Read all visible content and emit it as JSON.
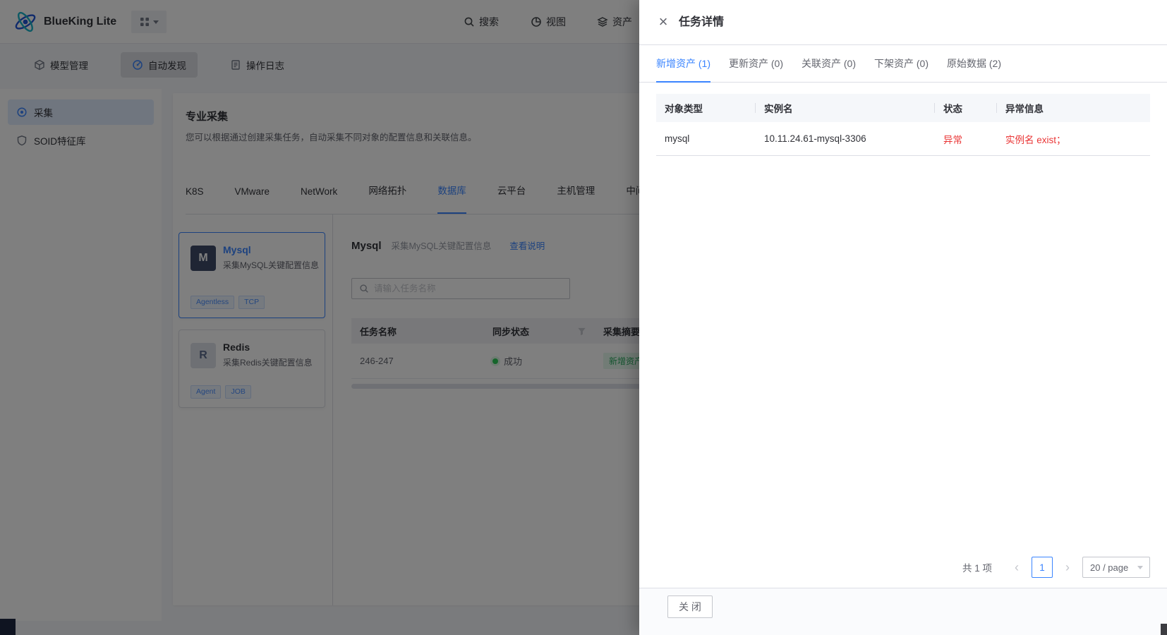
{
  "colors": {
    "accent": "#3a84ff",
    "error": "#ea3636",
    "success": "#2dcb56"
  },
  "icons": {
    "close": "×",
    "prev": "‹",
    "next": "›"
  },
  "navbar": {
    "brand": "BlueKing Lite",
    "search": "搜索",
    "views": "视图",
    "assets": "资产"
  },
  "subnav": {
    "model": "模型管理",
    "discovery": "自动发现",
    "logs": "操作日志"
  },
  "sidebar": {
    "items": [
      {
        "label": "采集"
      },
      {
        "label": "SOID特征库"
      }
    ]
  },
  "panel": {
    "title": "专业采集",
    "desc": "您可以根据通过创建采集任务，自动采集不同对象的配置信息和关联信息。",
    "tabs": [
      {
        "label": "K8S"
      },
      {
        "label": "VMware"
      },
      {
        "label": "NetWork"
      },
      {
        "label": "网络拓扑"
      },
      {
        "label": "数据库"
      },
      {
        "label": "云平台"
      },
      {
        "label": "主机管理"
      },
      {
        "label": "中间件"
      }
    ],
    "cards": [
      {
        "initial": "M",
        "title": "Mysql",
        "desc": "采集MySQL关键配置信息",
        "tags": [
          "Agentless",
          "TCP"
        ]
      },
      {
        "initial": "R",
        "title": "Redis",
        "desc": "采集Redis关键配置信息",
        "tags": [
          "Agent",
          "JOB"
        ]
      }
    ],
    "detail": {
      "title": "Mysql",
      "subtitle": "采集MySQL关键配置信息",
      "doc_link": "查看说明",
      "search_placeholder": "请输入任务名称",
      "table": {
        "col_name": "任务名称",
        "col_status": "同步状态",
        "col_summary": "采集摘要",
        "rows": [
          {
            "name": "246-247",
            "status": "成功",
            "summary": "新增资产:"
          }
        ]
      }
    }
  },
  "drawer": {
    "title": "任务详情",
    "tabs": [
      {
        "label": "新增资产 (1)"
      },
      {
        "label": "更新资产 (0)"
      },
      {
        "label": "关联资产 (0)"
      },
      {
        "label": "下架资产 (0)"
      },
      {
        "label": "原始数据 (2)"
      }
    ],
    "table": {
      "headers": [
        "对象类型",
        "实例名",
        "状态",
        "异常信息"
      ],
      "rows": [
        {
          "type": "mysql",
          "instance": "10.11.24.61-mysql-3306",
          "status": "异常",
          "error": "实例名 exist；"
        }
      ]
    },
    "pagination": {
      "total": "共 1 项",
      "page": "1",
      "per_page": "20 / page"
    },
    "close_label": "关 闭"
  }
}
